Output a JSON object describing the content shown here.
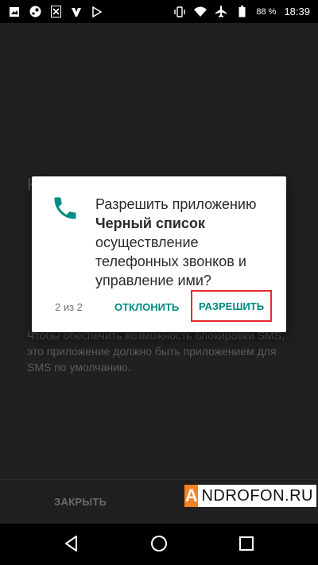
{
  "status_bar": {
    "battery_percent": "88 %",
    "time": "18:39"
  },
  "background_app": {
    "title_partial": "Н",
    "text": "Чтобы обеспечить возможность блокировки SMS, это приложение должно быть приложением для SMS по умолчанию.",
    "close_button": "ЗАКРЫТЬ"
  },
  "dialog": {
    "line1": "Разрешить приложению",
    "app_name": "Черный список",
    "line2": "осуществление телефонных звонков и управление ими?",
    "counter": "2 из 2",
    "deny_label": "ОТКЛОНИТЬ",
    "allow_label": "РАЗРЕШИТЬ",
    "accent_color": "#008a80",
    "highlight_color": "#e32b2b"
  },
  "watermark": {
    "first_letter": "A",
    "rest": "NDROFON.RU"
  }
}
